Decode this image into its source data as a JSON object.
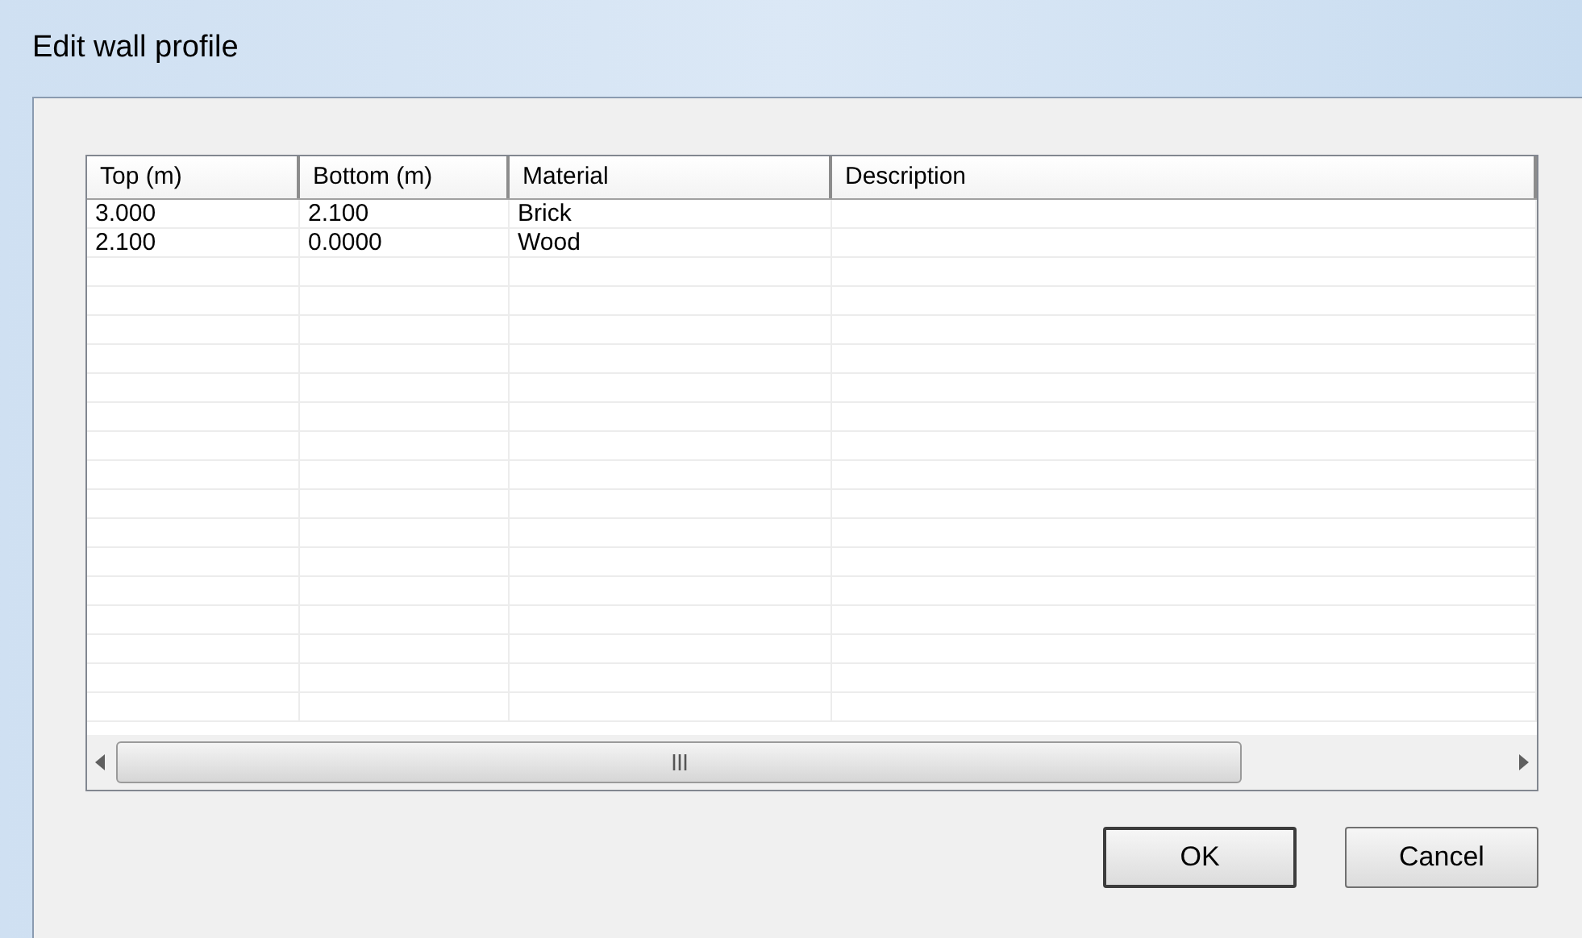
{
  "window": {
    "title": "Edit wall profile"
  },
  "table": {
    "columns": [
      "Top (m)",
      "Bottom (m)",
      "Material",
      "Description"
    ],
    "rows": [
      [
        "3.000",
        "2.100",
        "Brick",
        ""
      ],
      [
        "2.100",
        "0.0000",
        "Wood",
        ""
      ]
    ]
  },
  "buttons": [
    {
      "label": "OK",
      "default": true
    },
    {
      "label": "Cancel",
      "default": false
    }
  ]
}
